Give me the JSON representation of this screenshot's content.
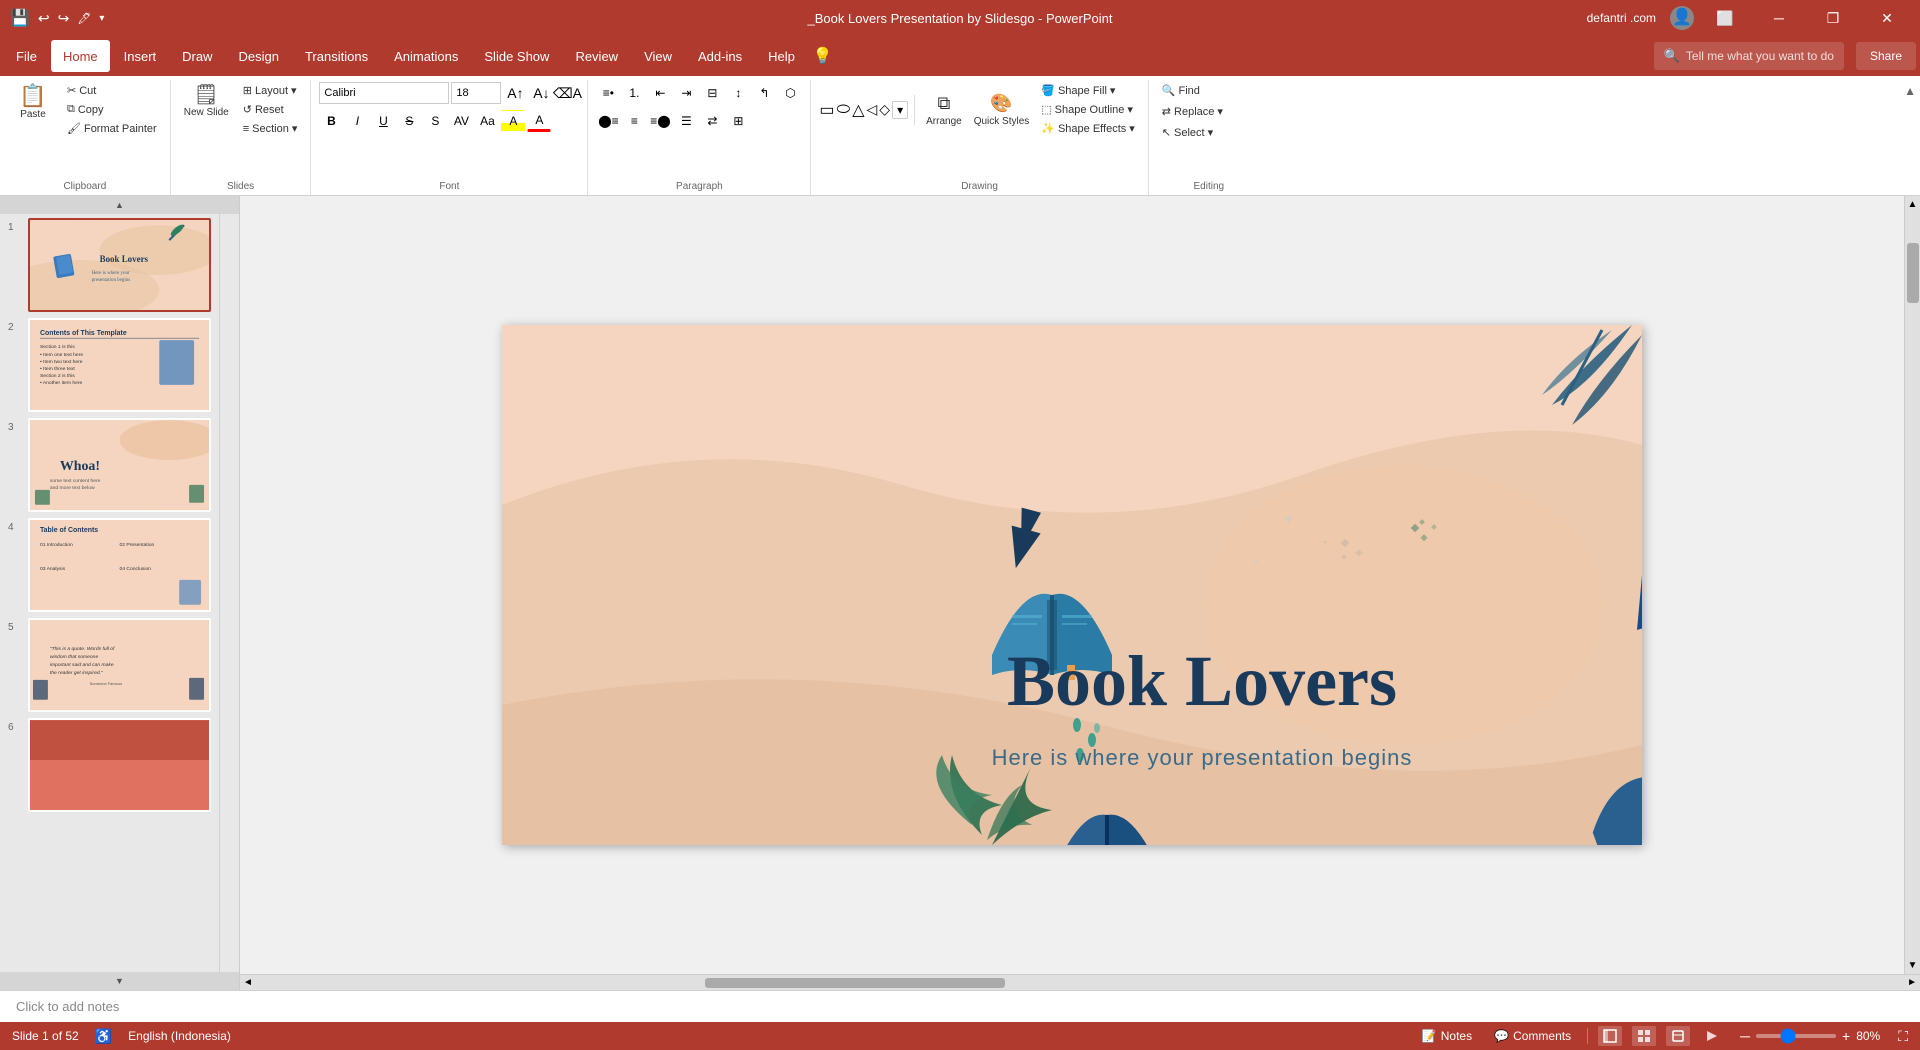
{
  "titlebar": {
    "title": "_Book Lovers Presentation by Slidesgo - PowerPoint",
    "user": "defantri .com",
    "quick_access": [
      "save",
      "undo",
      "redo",
      "customize"
    ]
  },
  "menubar": {
    "items": [
      "File",
      "Home",
      "Insert",
      "Draw",
      "Design",
      "Transitions",
      "Animations",
      "Slide Show",
      "Review",
      "View",
      "Add-ins",
      "Help"
    ],
    "active": "Home",
    "search_placeholder": "Tell me what you want to do",
    "share_label": "Share"
  },
  "ribbon": {
    "groups": {
      "clipboard": {
        "label": "Clipboard",
        "paste_label": "Paste",
        "cut_label": "Cut",
        "copy_label": "Copy",
        "format_painter_label": "Format Painter"
      },
      "slides": {
        "label": "Slides",
        "new_slide_label": "New\nSlide",
        "layout_label": "Layout",
        "reset_label": "Reset",
        "section_label": "Section"
      },
      "font": {
        "label": "Font",
        "font_name": "Calibri",
        "font_size": "18",
        "bold": "B",
        "italic": "I",
        "underline": "U",
        "strikethrough": "S"
      },
      "paragraph": {
        "label": "Paragraph"
      },
      "drawing": {
        "label": "Drawing",
        "arrange_label": "Arrange",
        "quick_styles_label": "Quick\nStyles",
        "shape_fill_label": "Shape Fill",
        "shape_outline_label": "Shape Outline",
        "shape_effects_label": "Shape Effects"
      },
      "editing": {
        "label": "Editing",
        "find_label": "Find",
        "replace_label": "Replace",
        "select_label": "Select"
      }
    }
  },
  "slides": [
    {
      "number": "1",
      "active": true,
      "title": "Book Lovers",
      "subtitle": "Here is where your presentation begins"
    },
    {
      "number": "2",
      "active": false,
      "title": "Contents of This Template"
    },
    {
      "number": "3",
      "active": false,
      "title": "Whoa!"
    },
    {
      "number": "4",
      "active": false,
      "title": "Table of Contents"
    },
    {
      "number": "5",
      "active": false,
      "title": ""
    },
    {
      "number": "6",
      "active": false,
      "title": ""
    }
  ],
  "main_slide": {
    "title": "Book Lovers",
    "subtitle": "Here is where your presentation begins"
  },
  "notes_placeholder": "Click to add notes",
  "statusbar": {
    "slide_info": "Slide 1 of 52",
    "language": "English (Indonesia)",
    "notes_label": "Notes",
    "comments_label": "Comments",
    "zoom": "80%"
  }
}
